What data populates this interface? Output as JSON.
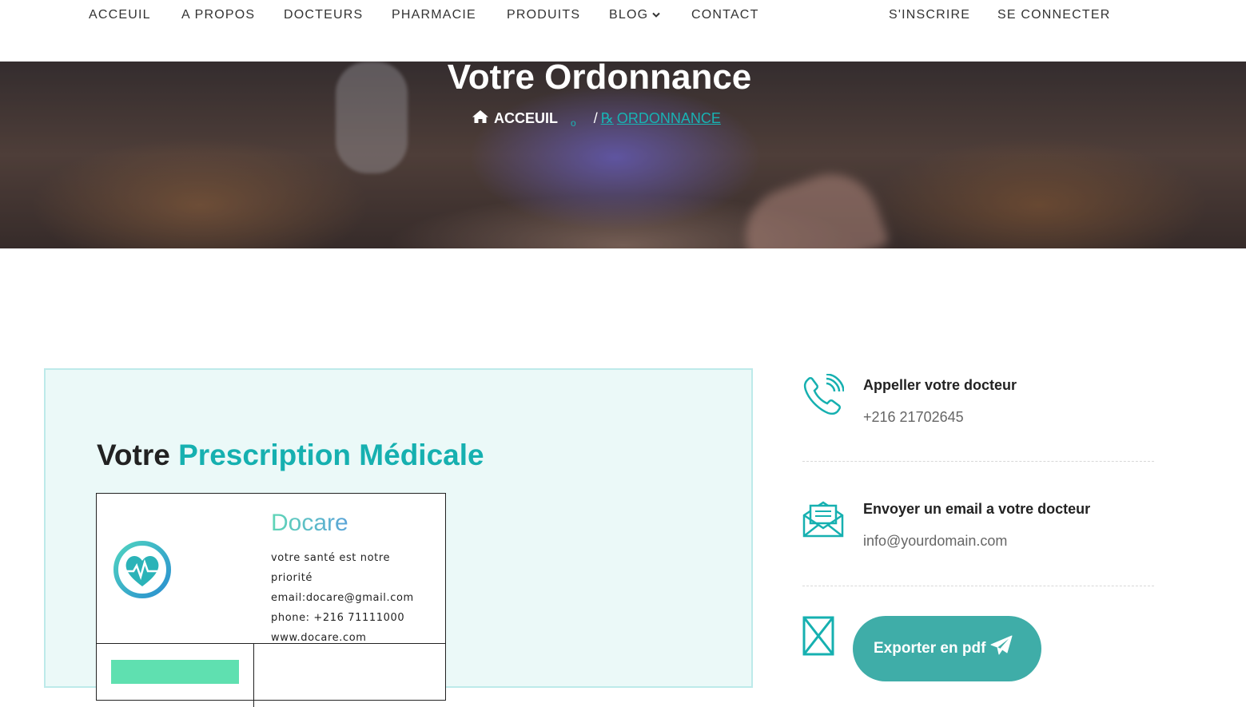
{
  "nav": {
    "items": [
      "ACCEUIL",
      "A PROPOS",
      "DOCTEURS",
      "PHARMACIE",
      "PRODUITS",
      "BLOG",
      "CONTACT"
    ],
    "right": [
      "S'INSCRIRE",
      "SE CONNECTER"
    ]
  },
  "hero": {
    "title": "Votre Ordonnance",
    "breadcrumb_home": "ACCEUIL",
    "breadcrumb_sep": "/",
    "breadcrumb_current": "ORDONNANCE",
    "breadcrumb_current_icon": "℞"
  },
  "card": {
    "title_plain": "Votre",
    "title_accent": "Prescription Médicale",
    "brand": "Docare",
    "info": [
      "votre santé est notre",
      "priorité",
      "email:docare@gmail.com",
      "phone: +216 71111000",
      "www.docare.com"
    ]
  },
  "contact": {
    "call_title": "Appeller votre docteur",
    "call_value": "+216 21702645",
    "email_title": "Envoyer un email a votre docteur",
    "email_value": "info@yourdomain.com",
    "export_label": "Exporter en pdf"
  },
  "colors": {
    "accent": "#16b0b0",
    "button": "#3fada8",
    "card_bg": "#ebf9f8"
  },
  "icons": {
    "call": "phone-ringing-icon",
    "email": "envelope-icon",
    "export": "file-x-icon",
    "send": "paper-plane-icon",
    "home": "home-icon"
  }
}
